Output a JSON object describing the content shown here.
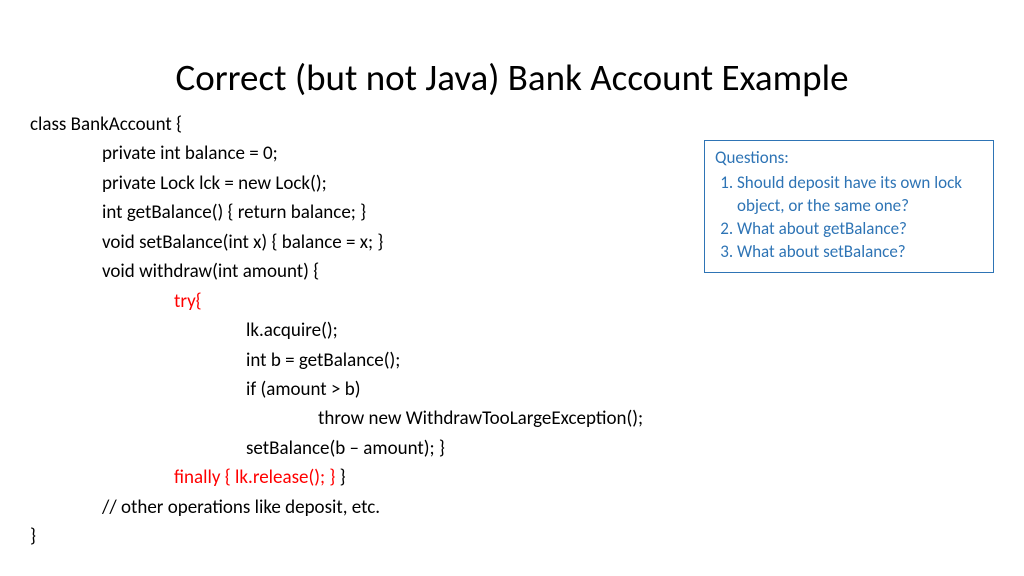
{
  "title": "Correct (but not Java) Bank Account Example",
  "code": {
    "l1": "class BankAccount {",
    "l2": "private int balance = 0;",
    "l3": "private Lock lck = new Lock();",
    "l4": "int getBalance() { return balance; }",
    "l5": "void setBalance(int x) { balance = x; }",
    "l6": "void withdraw(int amount) {",
    "l7": "try{",
    "l8": "lk.acquire();",
    "l9": "int b = getBalance();",
    "l10": "if (amount > b)",
    "l11": "throw new WithdrawTooLargeException();",
    "l12": "setBalance(b – amount); }",
    "l13a": "finally { lk.release(); }",
    "l13b": " }",
    "l14": "// other operations like deposit, etc.",
    "l15": "}"
  },
  "questions": {
    "header": "Questions:",
    "items": [
      "Should deposit have its own lock object, or the same one?",
      "What about getBalance?",
      "What about setBalance?"
    ]
  }
}
